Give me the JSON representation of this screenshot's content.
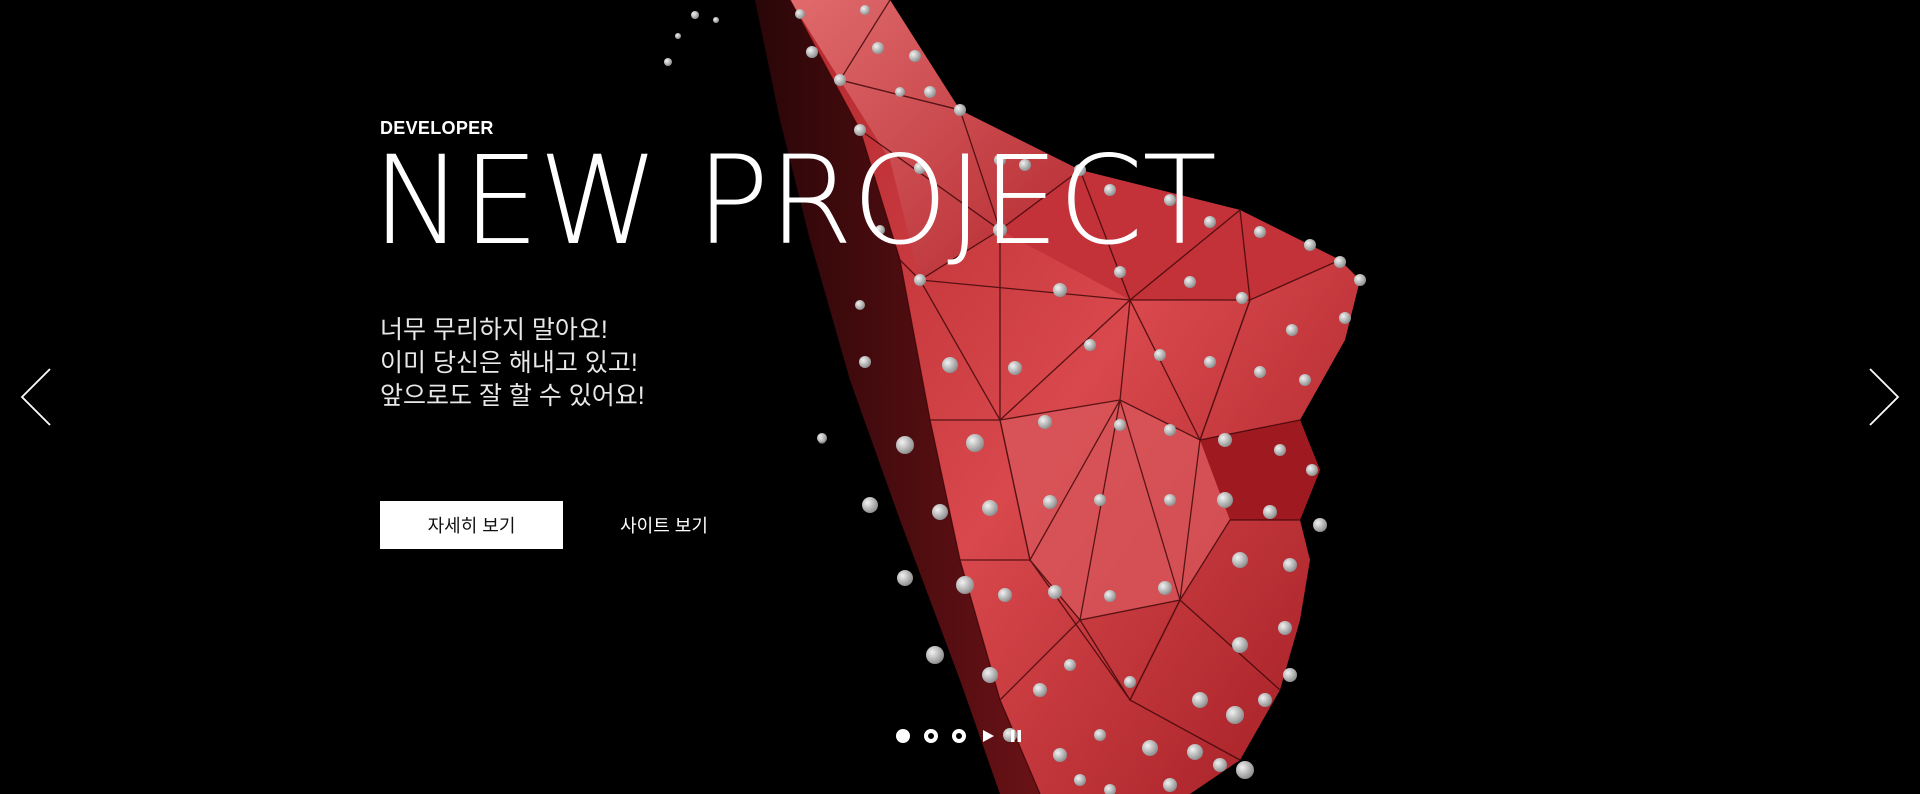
{
  "hero": {
    "category": "DEVELOPER",
    "title": "NEW PROJECT",
    "description": [
      "너무 무리하지 말아요!",
      "이미 당신은 해내고 있고!",
      "앞으로도 잘 할 수 있어요!"
    ],
    "primary_button": "자세히 보기",
    "secondary_button": "사이트 보기"
  },
  "navigation": {
    "prev_icon": "chevron-left-icon",
    "next_icon": "chevron-right-icon"
  },
  "pagination": {
    "dots": 3,
    "active_index": 0,
    "play_icon": "play-icon",
    "pause_icon": "pause-icon"
  },
  "colors": {
    "background": "#000000",
    "accent_red": "#c8323a",
    "text": "#ffffff"
  }
}
